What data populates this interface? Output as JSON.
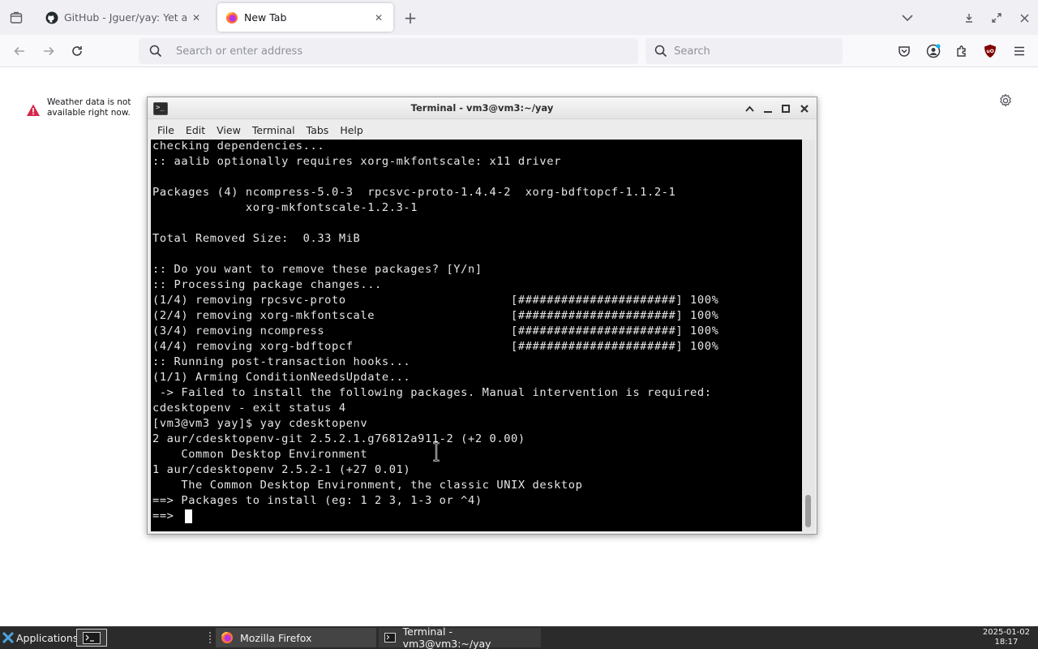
{
  "browser": {
    "tabs": [
      {
        "title": "GitHub - Jguer/yay: Yet ano",
        "favicon": "github-icon",
        "active": false
      },
      {
        "title": "New Tab",
        "favicon": "firefox-icon",
        "active": true
      }
    ],
    "urlbar": {
      "placeholder": "Search or enter address",
      "value": ""
    },
    "searchbar": {
      "placeholder": "Search",
      "value": ""
    }
  },
  "newtab": {
    "weather_message": "Weather data is not available right now."
  },
  "terminal": {
    "title": "Terminal - vm3@vm3:~/yay",
    "menu": [
      "File",
      "Edit",
      "View",
      "Terminal",
      "Tabs",
      "Help"
    ],
    "output": "checking dependencies...\n:: aalib optionally requires xorg-mkfontscale: x11 driver\n\nPackages (4) ncompress-5.0-3  rpcsvc-proto-1.4.4-2  xorg-bdftopcf-1.1.2-1\n             xorg-mkfontscale-1.2.3-1\n\nTotal Removed Size:  0.33 MiB\n\n:: Do you want to remove these packages? [Y/n]\n:: Processing package changes...\n(1/4) removing rpcsvc-proto                       [######################] 100%\n(2/4) removing xorg-mkfontscale                   [######################] 100%\n(3/4) removing ncompress                          [######################] 100%\n(4/4) removing xorg-bdftopcf                      [######################] 100%\n:: Running post-transaction hooks...\n(1/1) Arming ConditionNeedsUpdate...\n -> Failed to install the following packages. Manual intervention is required:\ncdesktopenv - exit status 4\n[vm3@vm3 yay]$ yay cdesktopenv\n2 aur/cdesktopenv-git 2.5.2.1.g76812a911-2 (+2 0.00)\n    Common Desktop Environment\n1 aur/cdesktopenv 2.5.2-1 (+27 0.01)\n    The Common Desktop Environment, the classic UNIX desktop\n==> Packages to install (eg: 1 2 3, 1-3 or ^4)",
    "prompt": "==> "
  },
  "taskbar": {
    "applications_label": "Applications",
    "tasks": [
      {
        "label": "Mozilla Firefox",
        "icon": "firefox-icon"
      },
      {
        "label": "Terminal - vm3@vm3:~/yay",
        "icon": "terminal-icon"
      }
    ],
    "date": "2025-01-02",
    "time": "18:17"
  },
  "colors": {
    "terminal_bg": "#000000",
    "terminal_fg": "#e6e6e6",
    "taskbar_bg": "#2b2b2b",
    "toolbar_bg": "#f9f9fb",
    "warning_red": "#d7264c"
  }
}
